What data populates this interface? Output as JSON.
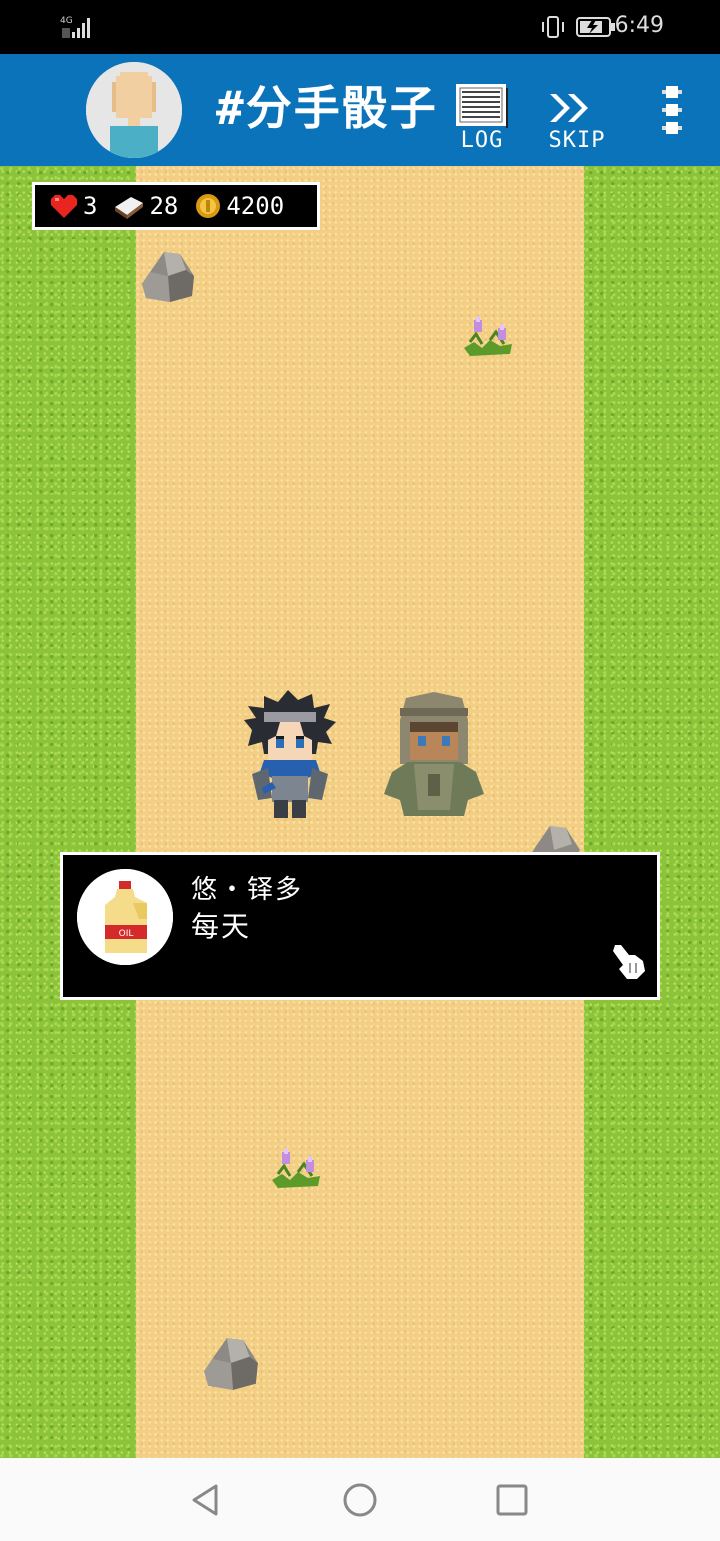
{
  "status_bar": {
    "network": "4G",
    "time": "6:49"
  },
  "header": {
    "title": "#分手骰子",
    "log_label": "LOG",
    "skip_label": "SKIP"
  },
  "hud": {
    "hearts": "3",
    "items": "28",
    "coins": "4200"
  },
  "dialog": {
    "speaker": "悠・铎多",
    "text": "每天",
    "portrait_label": "OIL"
  },
  "colors": {
    "header_bg": "#0b73b9",
    "grass": "#8bc43a",
    "road": "#f3cf86"
  },
  "icons": [
    "heart-icon",
    "book-icon",
    "coin-icon",
    "log-icon",
    "skip-icon",
    "more-vert-icon",
    "hand-pointer-icon",
    "back-icon",
    "home-icon",
    "recents-icon"
  ]
}
